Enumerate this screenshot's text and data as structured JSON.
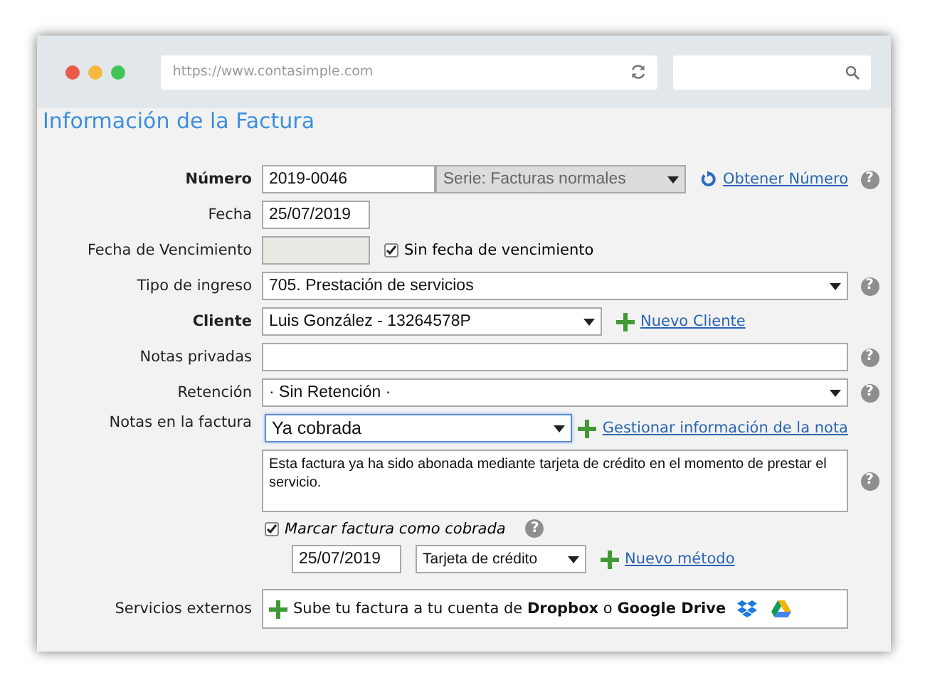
{
  "browser": {
    "url": "https://www.contasimple.com"
  },
  "title": "Información de la Factura",
  "rows": [
    {
      "kind": "number",
      "label": "Número",
      "bold": true,
      "value": "2019-0046",
      "series": "Serie: Facturas normales",
      "link": "Obtener Número",
      "help": "?"
    },
    {
      "kind": "date",
      "label": "Fecha",
      "bold": false,
      "value": "25/07/2019"
    },
    {
      "kind": "due-date",
      "label": "Fecha de Vencimiento",
      "bold": false,
      "disabled": true,
      "checkbox": {
        "label": "Sin fecha de vencimiento",
        "checked": true
      }
    },
    {
      "kind": "select",
      "label": "Tipo de ingreso",
      "bold": false,
      "value": "705. Prestación de servicios",
      "help": "?"
    },
    {
      "kind": "client",
      "label": "Cliente",
      "bold": true,
      "value": "Luis González - 13264578P",
      "link": "Nuevo Cliente"
    },
    {
      "kind": "textarea",
      "label": "Notas privadas",
      "bold": false,
      "help": "?"
    },
    {
      "kind": "select",
      "label": "Retención",
      "bold": false,
      "value": "· Sin Retención ·",
      "help": "?"
    },
    {
      "kind": "notes",
      "label": "Notas en la factura",
      "bold": false,
      "value": "Ya cobrada",
      "focused": true,
      "link": "Gestionar información de la nota",
      "text": "Esta factura ya ha sido abonada mediante tarjeta de crédito en el momento de prestar el servicio.",
      "help": "?"
    },
    {
      "kind": "paid",
      "checkbox": {
        "label": "Marcar factura como cobrada",
        "checked": true
      },
      "help": "?",
      "date": "25/07/2019",
      "method": "Tarjeta de crédito",
      "link": "Nuevo método"
    },
    {
      "kind": "external",
      "label": "Servicios externos",
      "bold": false,
      "text": "Sube tu factura a tu cuenta de **Dropbox** o **Google Drive**"
    }
  ]
}
